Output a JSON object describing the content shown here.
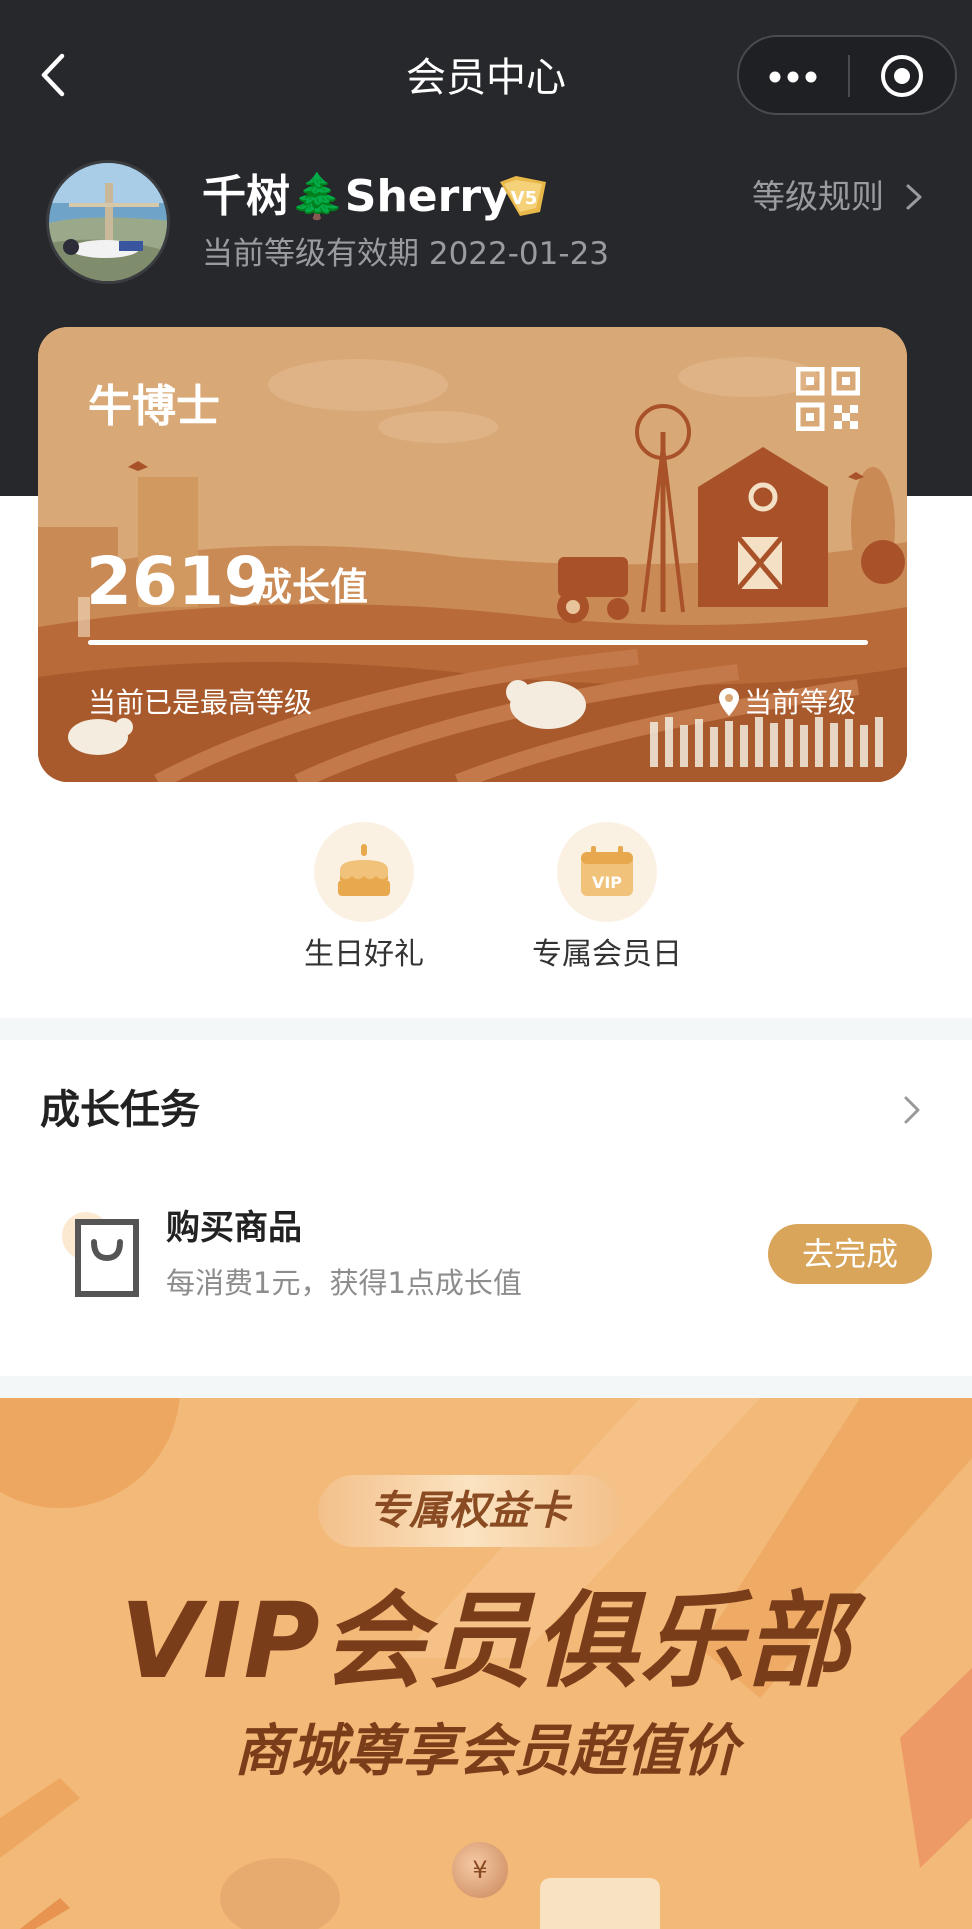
{
  "nav": {
    "title": "会员中心"
  },
  "user": {
    "name": "千树🌲Sherry",
    "level_badge": "V5",
    "validity": "当前等级有效期 2022-01-23",
    "level_rules_label": "等级规则"
  },
  "card": {
    "level_name": "牛博士",
    "points": "2619",
    "points_unit": "成长值",
    "progress_fraction": 1.0,
    "max_level_text": "当前已是最高等级",
    "current_level_text": "当前等级"
  },
  "benefits": [
    {
      "label": "生日好礼",
      "icon": "birthday-cake-icon"
    },
    {
      "label": "专属会员日",
      "icon": "vip-calendar-icon"
    }
  ],
  "tasks": {
    "title": "成长任务",
    "items": [
      {
        "title": "购买商品",
        "description": "每消费1元，获得1点成长值",
        "button": "去完成",
        "icon": "shopping-bag-icon"
      }
    ]
  },
  "banner": {
    "pill": "专属权益卡",
    "title": "VIP会员俱乐部",
    "subtitle": "商城尊享会员超值价",
    "coin": "¥"
  },
  "colors": {
    "header_bg": "#27282b",
    "card_bg": "#d8a876",
    "accent_gold": "#d9a55a",
    "banner_bg": "#f2b978"
  }
}
